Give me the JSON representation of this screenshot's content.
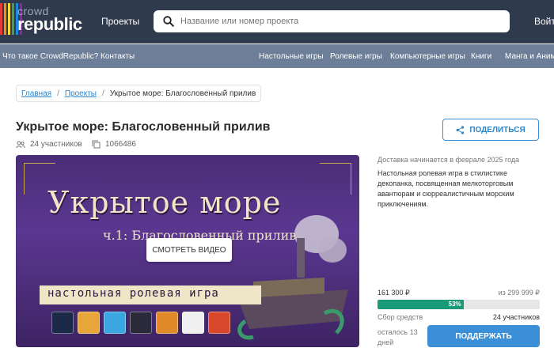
{
  "header": {
    "logo_top": "crowd",
    "logo_bottom": "republic",
    "logo_colors": [
      "#e53935",
      "#fb8c00",
      "#fdd835",
      "#43a047",
      "#1e88e5",
      "#8e24aa"
    ],
    "projects_link": "Проекты",
    "search_placeholder": "Название или номер проекта",
    "login": "Войти"
  },
  "subnav": {
    "items": [
      "Что такое CrowdRepublic?",
      "Контакты",
      "Настольные игры",
      "Ролевые игры",
      "Компьютерные игры",
      "Книги",
      "Манга и Аниме"
    ]
  },
  "breadcrumb": {
    "home": "Главная",
    "projects": "Проекты",
    "current": "Укрытое море: Благословенный прилив"
  },
  "project": {
    "title": "Укрытое море: Благословенный прилив",
    "participants": "24 участников",
    "number": "1066486",
    "share_label": "ПОДЕЛИТЬСЯ",
    "delivery": "Доставка начинается в феврале 2025 года",
    "description": "Настольная ролевая игра в стилистике декопанка, посвященная мелкоторговым авантюрам и сюрреалистичным морским приключениям.",
    "raised": "161 300 ₽",
    "goal": "из 299 999 ₽",
    "progress_percent": 53,
    "progress_label": "53%",
    "fund_label": "Сбор средств",
    "participants_count": "24 участников",
    "time_left": "осталось 13 дней",
    "support_label": "ПОДДЕРЖАТЬ"
  },
  "banner": {
    "title": "Укрытое море",
    "subtitle": "ч.1: Благословенный прилив",
    "strip": "настольная ролевая игра",
    "video_button": "СМОТРЕТЬ ВИДЕО",
    "badge_colors": [
      "#1c2a4a",
      "#e8a53a",
      "#3aa7e0",
      "#2a2a3a",
      "#e08a2a",
      "#f0f0f0",
      "#d9472a"
    ]
  },
  "colors": {
    "header_bg": "#2f3a4c",
    "subnav_bg": "#6d7f98",
    "accent": "#3a8fd6",
    "progress": "#1a9a78"
  }
}
